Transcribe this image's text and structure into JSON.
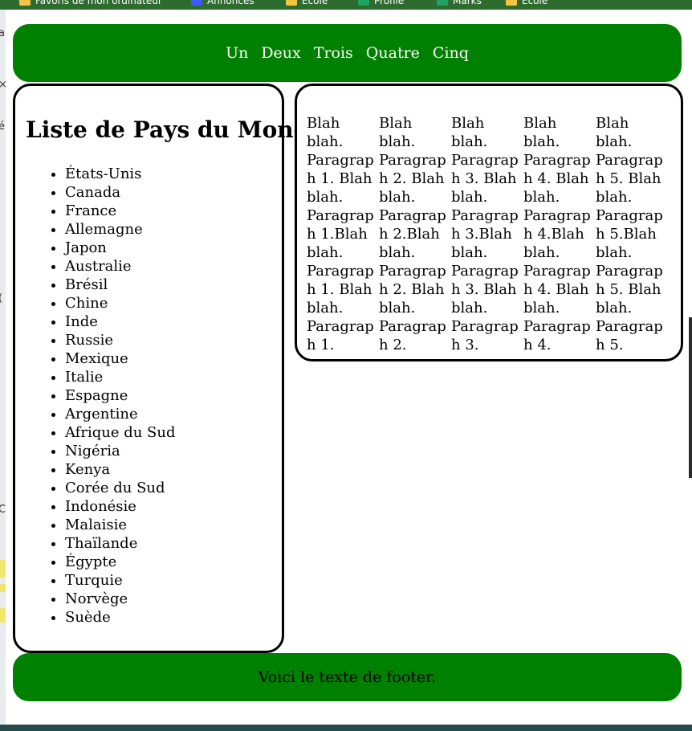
{
  "bookmarks": [
    {
      "label": "Favoris de mon ordinateur",
      "icon": "folder-icon",
      "color": "#f4c542"
    },
    {
      "label": "Annonces",
      "icon": "app-icon",
      "color": "#3d5afe"
    },
    {
      "label": "Ecole",
      "icon": "folder-icon",
      "color": "#f4c542"
    },
    {
      "label": "Profile",
      "icon": "sheet-icon",
      "color": "#1ea362"
    },
    {
      "label": "Marks",
      "icon": "sheet-icon",
      "color": "#1ea362"
    },
    {
      "label": "Ecole",
      "icon": "folder-icon",
      "color": "#f4c542"
    }
  ],
  "nav": {
    "links": [
      "Un",
      "Deux",
      "Trois",
      "Quatre",
      "Cinq"
    ]
  },
  "sidebar": {
    "title": "Liste de Pays du Monde",
    "countries": [
      "États-Unis",
      "Canada",
      "France",
      "Allemagne",
      "Japon",
      "Australie",
      "Brésil",
      "Chine",
      "Inde",
      "Russie",
      "Mexique",
      "Italie",
      "Espagne",
      "Argentine",
      "Afrique du Sud",
      "Nigéria",
      "Kenya",
      "Corée du Sud",
      "Indonésie",
      "Malaisie",
      "Thaïlande",
      "Égypte",
      "Turquie",
      "Norvège",
      "Suède"
    ]
  },
  "content": {
    "columns": [
      "Blah blah. Paragraph 1. Blah blah. Paragraph 1.Blah blah. Paragraph 1. Blah blah. Paragraph 1.",
      "Blah blah. Paragraph 2. Blah blah. Paragraph 2.Blah blah. Paragraph 2. Blah blah. Paragraph 2.",
      "Blah blah. Paragraph 3. Blah blah. Paragraph 3.Blah blah. Paragraph 3. Blah blah. Paragraph 3.",
      "Blah blah. Paragraph 4. Blah blah. Paragraph 4.Blah blah. Paragraph 4. Blah blah. Paragraph 4.",
      "Blah blah. Paragraph 5. Blah blah. Paragraph 5.Blah blah. Paragraph 5. Blah blah. Paragraph 5."
    ]
  },
  "footer": {
    "text": "Voici le texte de footer."
  },
  "colors": {
    "header_bg": "#008000",
    "footer_bg": "#008000",
    "border": "#000000"
  }
}
